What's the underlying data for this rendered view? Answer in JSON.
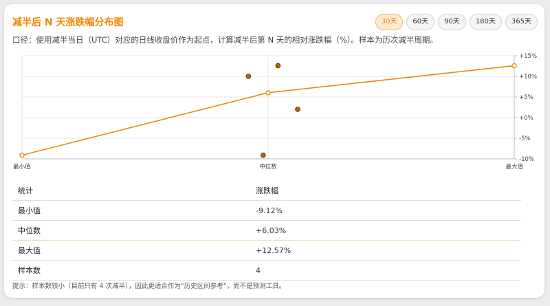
{
  "title": "减半后 N 天涨跌幅分布图",
  "tabs": [
    {
      "label": "30天",
      "active": true
    },
    {
      "label": "60天",
      "active": false
    },
    {
      "label": "90天",
      "active": false
    },
    {
      "label": "180天",
      "active": false
    },
    {
      "label": "365天",
      "active": false
    }
  ],
  "description": "口径：使用减半当日（UTC）对应的日线收盘价作为起点，计算减半后第 N 天的相对涨跌幅（%）。样本为历次减半周期。",
  "colors": {
    "accent": "#f0870a",
    "dot": "#b8600a"
  },
  "chart_data": {
    "type": "line",
    "categories": [
      "最小值",
      "中位数",
      "最大值"
    ],
    "series": [
      {
        "values": [
          -9.12,
          6.03,
          12.57
        ]
      }
    ],
    "scatter": [
      {
        "x": 0.46,
        "y": 10.0
      },
      {
        "x": 0.52,
        "y": 12.57
      },
      {
        "x": 0.56,
        "y": 2.0
      },
      {
        "x": 0.49,
        "y": -9.12
      }
    ],
    "ylim": [
      -10,
      15
    ],
    "yticks": [
      "+15%",
      "+10%",
      "+5%",
      "+0%",
      "-5%",
      "-10%"
    ],
    "ytick_values": [
      15,
      10,
      5,
      0,
      -5,
      -10
    ],
    "grid": true
  },
  "table": {
    "headers": [
      "统计",
      "涨跌幅"
    ],
    "rows": [
      [
        "最小值",
        "-9.12%"
      ],
      [
        "中位数",
        "+6.03%"
      ],
      [
        "最大值",
        "+12.57%"
      ],
      [
        "样本数",
        "4"
      ]
    ]
  },
  "note": "提示：样本数较小（目前只有 4 次减半），因此更适合作为“历史区间参考”，而不是预测工具。"
}
